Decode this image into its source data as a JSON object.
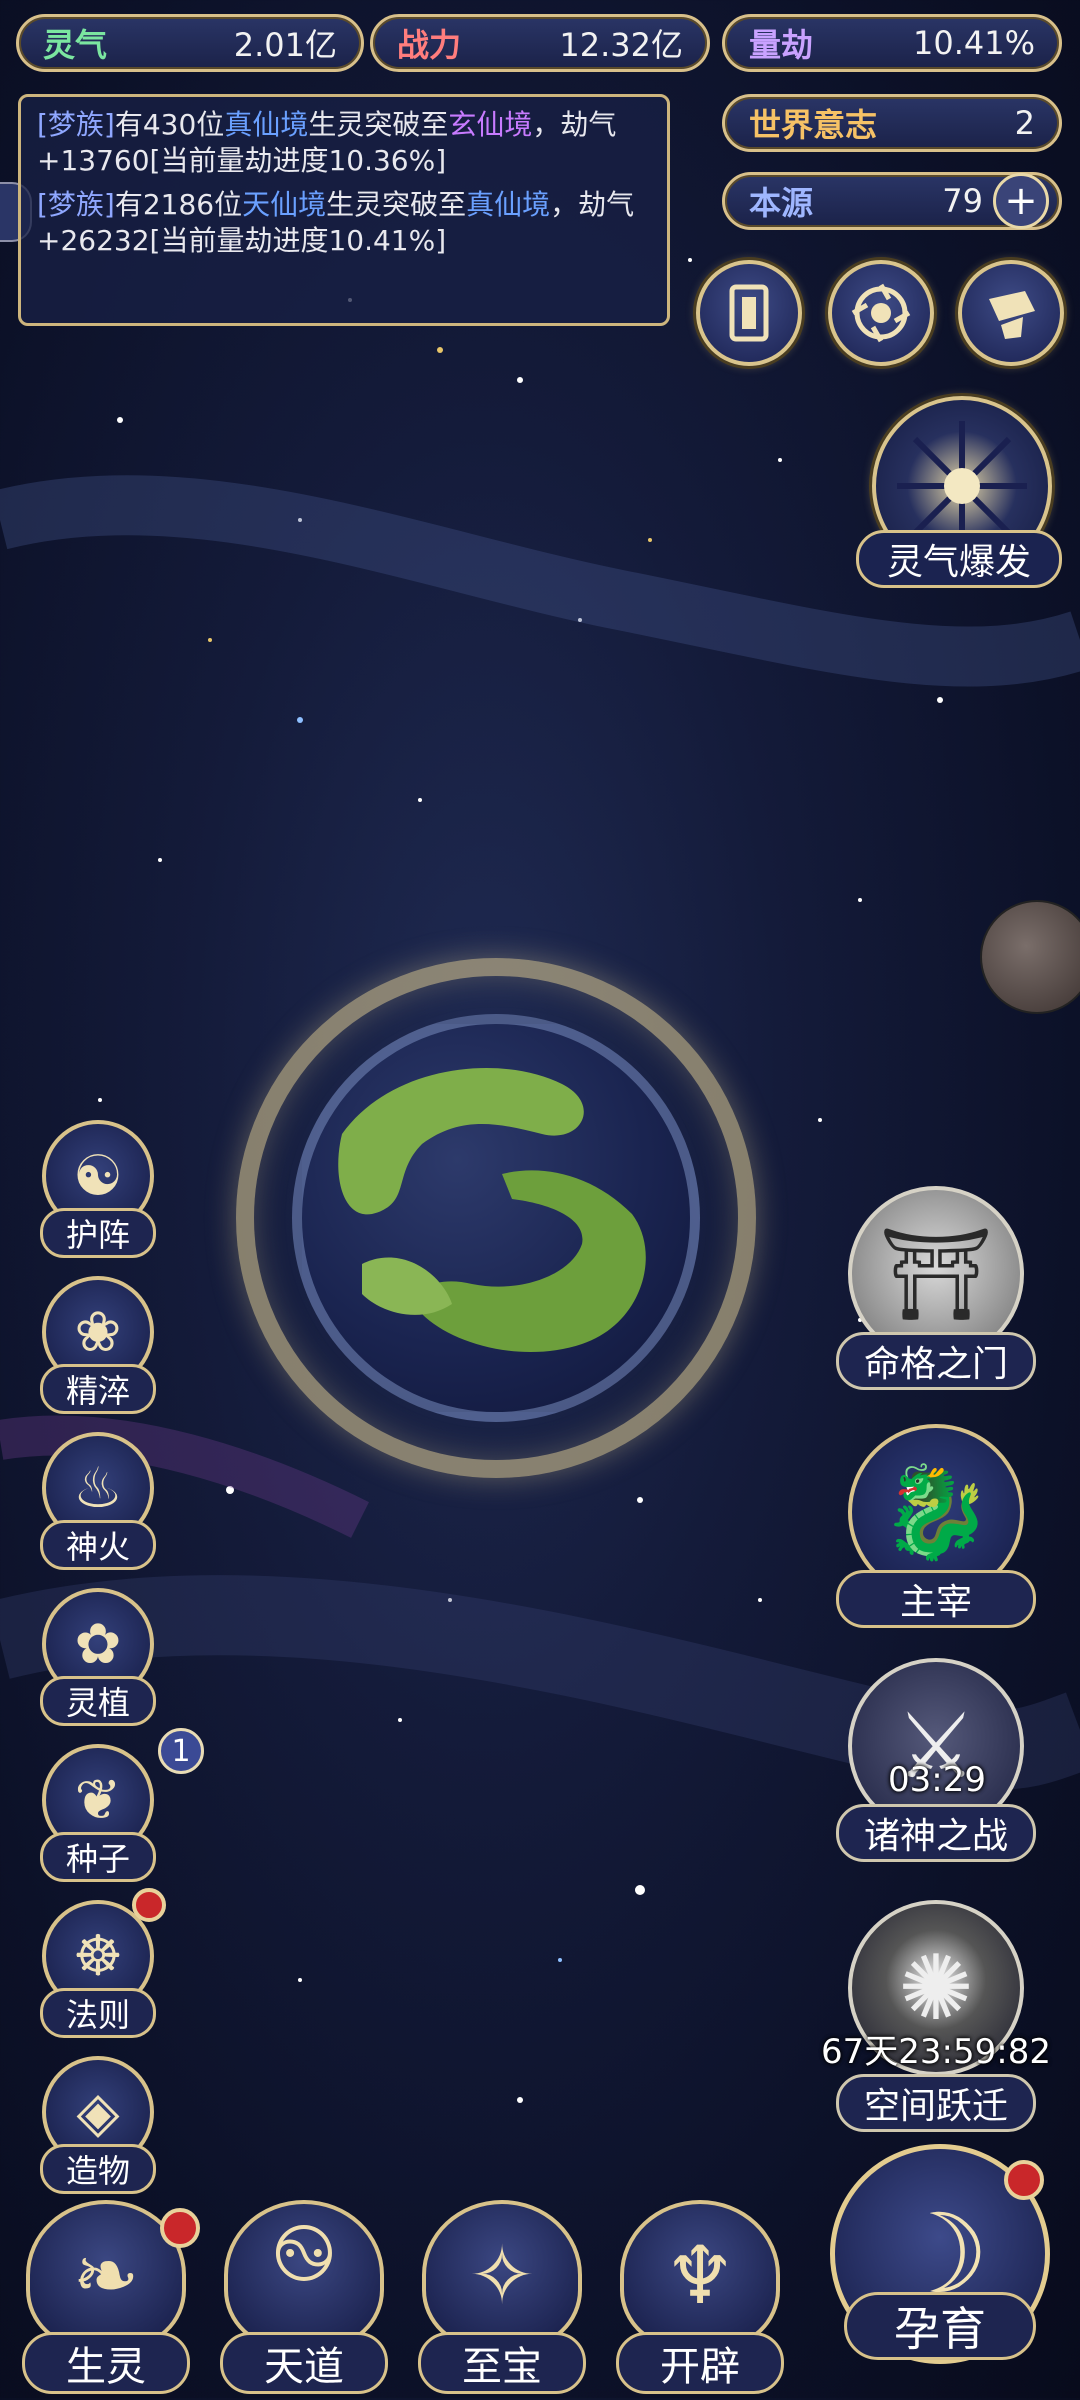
{
  "resources": {
    "lingqi": {
      "label": "灵气",
      "value": "2.01亿"
    },
    "zhanli": {
      "label": "战力",
      "value": "12.32亿"
    },
    "liangjie": {
      "label": "量劫",
      "value": "10.41%"
    },
    "world_will": {
      "label": "世界意志",
      "value": "2"
    },
    "benyuan": {
      "label": "本源",
      "value": "79",
      "add": "+"
    }
  },
  "log": [
    {
      "clan": "[梦族]",
      "t1": "有430位",
      "from": "真仙境",
      "t2": "生灵突破至",
      "to": "玄仙境",
      "t3": "，劫气+13760[当前量劫进度10.36%]"
    },
    {
      "clan": "[梦族]",
      "t1": "有2186位",
      "from": "天仙境",
      "t2": "生灵突破至",
      "to": "真仙境",
      "t3": "，劫气+26232[当前量劫进度10.41%]"
    }
  ],
  "right_top": {
    "burst_label": "灵气爆发"
  },
  "left_menu": [
    {
      "label": "护阵",
      "icon": "yin-yang-icon"
    },
    {
      "label": "精淬",
      "icon": "lotus-flame-icon"
    },
    {
      "label": "神火",
      "icon": "fire-icon"
    },
    {
      "label": "灵植",
      "icon": "plant-icon"
    },
    {
      "label": "种子",
      "icon": "seed-icon",
      "badge": "1"
    },
    {
      "label": "法则",
      "icon": "law-icon"
    },
    {
      "label": "造物",
      "icon": "creation-icon"
    }
  ],
  "right_menu": {
    "fate_gate": "命格之门",
    "master": "主宰",
    "gods_war": "诸神之战",
    "gods_war_timer": "03:29",
    "space_jump": "空间跃迁",
    "space_jump_timer": "67天23:59:82"
  },
  "bottom_menu": {
    "creatures": "生灵",
    "heaven": "天道",
    "treasure": "至宝",
    "open": "开辟",
    "breed": "孕育"
  },
  "colors": {
    "gold": "#d8c28a",
    "badge_red": "#c9272a",
    "clan_blue": "#8fa7ff",
    "realm_blue": "#6aa0ff",
    "realm_purple": "#c87bff"
  }
}
